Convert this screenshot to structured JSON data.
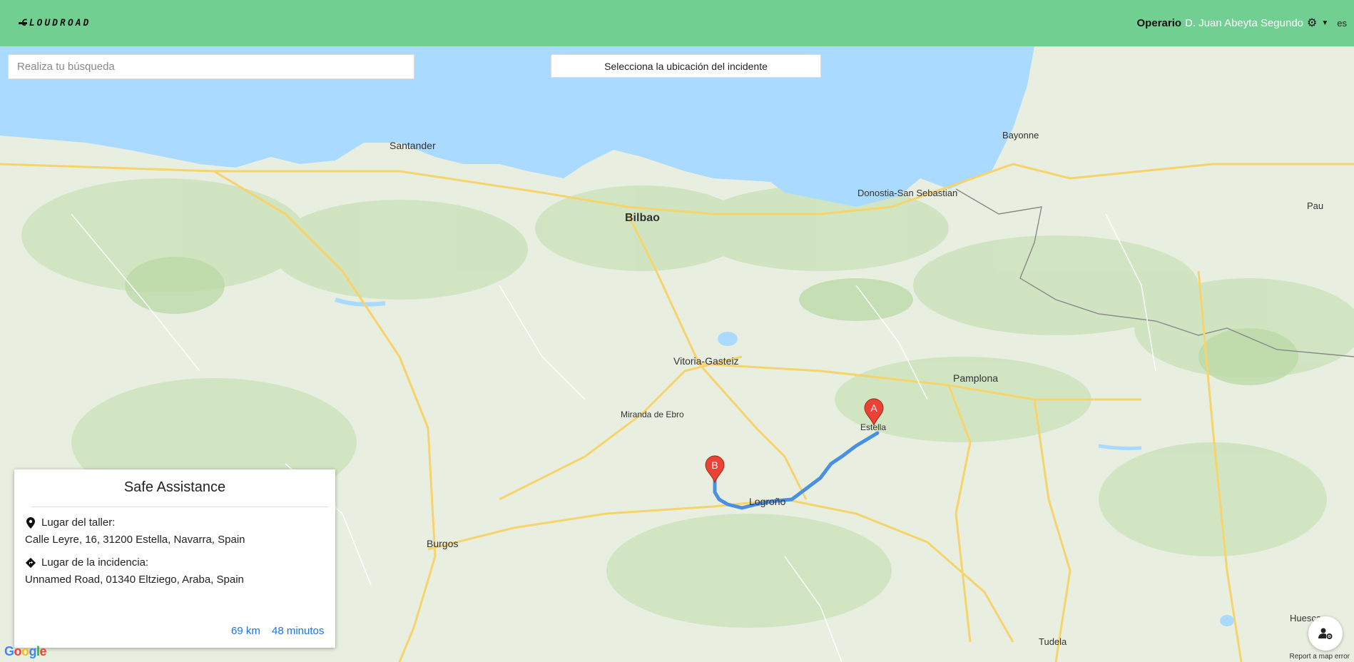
{
  "header": {
    "logo_text": "CLOUDROAD",
    "role_label": "Operario",
    "user_name": "D. Juan Abeyta Segundo",
    "language": "es"
  },
  "search": {
    "placeholder": "Realiza tu búsqueda"
  },
  "incident_button": {
    "label": "Selecciona la ubicación del incidente"
  },
  "card": {
    "title": "Safe Assistance",
    "workshop_label": "Lugar del taller:",
    "workshop_address": "Calle Leyre, 16, 31200 Estella, Navarra, Spain",
    "incident_label": "Lugar de la incidencia:",
    "incident_address": "Unnamed Road, 01340 Eltziego, Araba, Spain",
    "distance": "69 km",
    "duration": "48 minutos"
  },
  "map": {
    "markers": [
      {
        "label": "A"
      },
      {
        "label": "B"
      }
    ],
    "google_logo": "Google",
    "report_link": "Report a map error",
    "cities_major": [
      "Bilbao",
      "Santander",
      "Vitoria-Gasteiz",
      "Pamplona",
      "Burgos",
      "Logroño",
      "Donostia-San Sebastian",
      "Bayonne",
      "Pau",
      "Huesca",
      "Tudela",
      "Estella",
      "Miranda de Ebro"
    ],
    "colors": {
      "sea": "#aadaff",
      "land": "#e8efe0",
      "route": "#4a90e2",
      "marker": "#ea4335"
    }
  }
}
